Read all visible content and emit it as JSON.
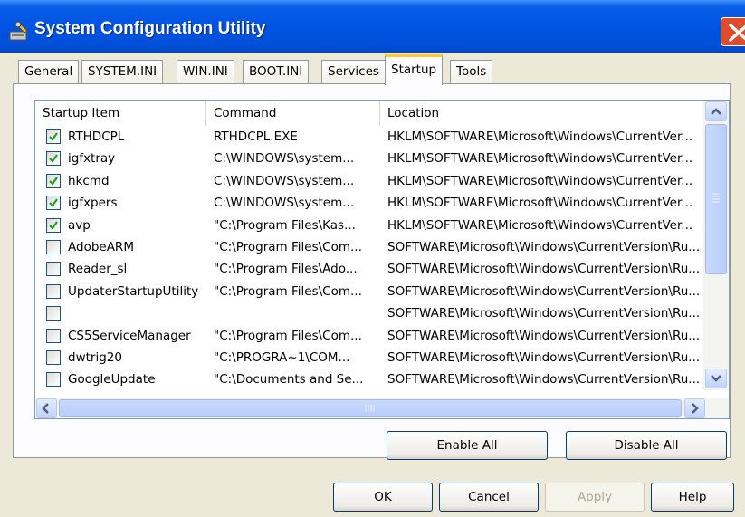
{
  "window": {
    "title": "System Configuration Utility"
  },
  "tabs": [
    {
      "label": "General"
    },
    {
      "label": "SYSTEM.INI"
    },
    {
      "label": "WIN.INI"
    },
    {
      "label": "BOOT.INI"
    },
    {
      "label": "Services"
    },
    {
      "label": "Startup",
      "active": true
    },
    {
      "label": "Tools"
    }
  ],
  "startup": {
    "columns": [
      "Startup Item",
      "Command",
      "Location"
    ],
    "rows": [
      {
        "checked": true,
        "item": "RTHDCPL",
        "command": "RTHDCPL.EXE",
        "location": "HKLM\\SOFTWARE\\Microsoft\\Windows\\CurrentVer..."
      },
      {
        "checked": true,
        "item": "igfxtray",
        "command": "C:\\WINDOWS\\system...",
        "location": "HKLM\\SOFTWARE\\Microsoft\\Windows\\CurrentVer..."
      },
      {
        "checked": true,
        "item": "hkcmd",
        "command": "C:\\WINDOWS\\system...",
        "location": "HKLM\\SOFTWARE\\Microsoft\\Windows\\CurrentVer..."
      },
      {
        "checked": true,
        "item": "igfxpers",
        "command": "C:\\WINDOWS\\system...",
        "location": "HKLM\\SOFTWARE\\Microsoft\\Windows\\CurrentVer..."
      },
      {
        "checked": true,
        "item": "avp",
        "command": "\"C:\\Program Files\\Kas...",
        "location": "HKLM\\SOFTWARE\\Microsoft\\Windows\\CurrentVer..."
      },
      {
        "checked": false,
        "item": "AdobeARM",
        "command": "\"C:\\Program Files\\Com...",
        "location": "SOFTWARE\\Microsoft\\Windows\\CurrentVersion\\Ru..."
      },
      {
        "checked": false,
        "item": "Reader_sl",
        "command": "\"C:\\Program Files\\Ado...",
        "location": "SOFTWARE\\Microsoft\\Windows\\CurrentVersion\\Ru..."
      },
      {
        "checked": false,
        "item": "UpdaterStartupUtility",
        "command": "\"C:\\Program Files\\Com...",
        "location": "SOFTWARE\\Microsoft\\Windows\\CurrentVersion\\Ru..."
      },
      {
        "checked": false,
        "item": "",
        "command": "",
        "location": "SOFTWARE\\Microsoft\\Windows\\CurrentVersion\\Ru..."
      },
      {
        "checked": false,
        "item": "CS5ServiceManager",
        "command": "\"C:\\Program Files\\Com...",
        "location": "SOFTWARE\\Microsoft\\Windows\\CurrentVersion\\Ru..."
      },
      {
        "checked": false,
        "item": "dwtrig20",
        "command": "\"C:\\PROGRA~1\\COM...",
        "location": "SOFTWARE\\Microsoft\\Windows\\CurrentVersion\\Ru..."
      },
      {
        "checked": false,
        "item": "GoogleUpdate",
        "command": "\"C:\\Documents and Se...",
        "location": "SOFTWARE\\Microsoft\\Windows\\CurrentVersion\\Ru..."
      }
    ]
  },
  "buttons": {
    "enable_all": "Enable All",
    "disable_all": "Disable All",
    "ok": "OK",
    "cancel": "Cancel",
    "apply": "Apply",
    "help": "Help"
  },
  "colors": {
    "titlebar": "#0054e3",
    "active_tab_accent": "#ffc83c",
    "close_button": "#e04c2b",
    "dialog_bg": "#ece9d8"
  },
  "icons": [
    "system-config-icon",
    "close-icon",
    "checkbox-checked-icon",
    "scroll-up-icon",
    "scroll-down-icon",
    "scroll-left-icon",
    "scroll-right-icon"
  ]
}
